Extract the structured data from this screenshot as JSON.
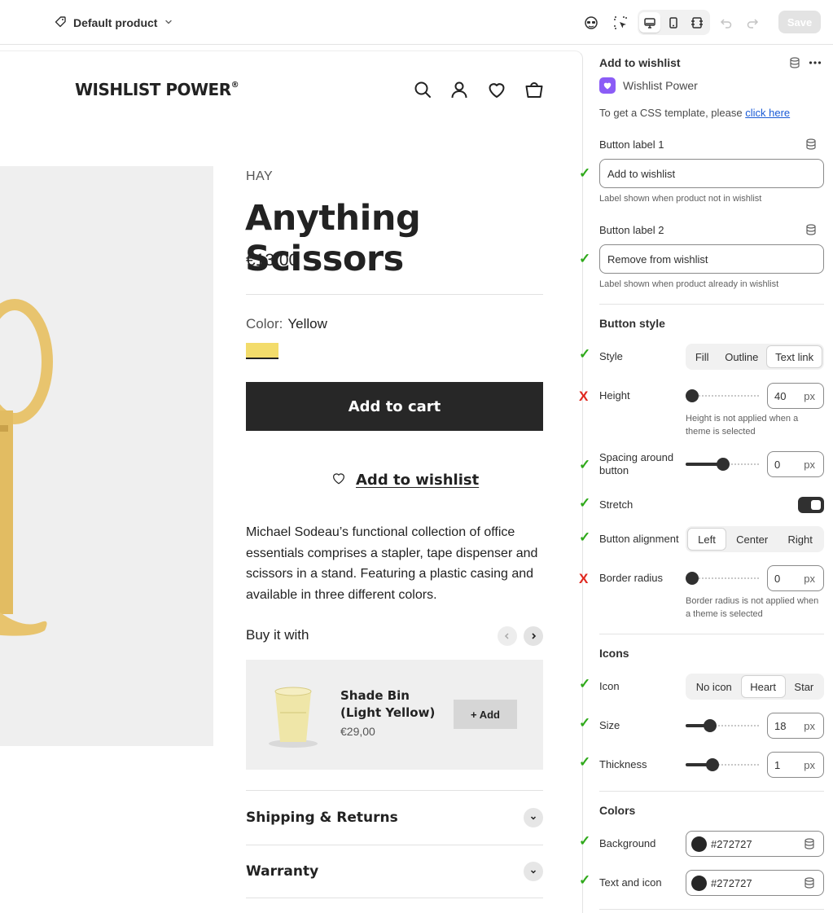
{
  "topbar": {
    "product_selector": "Default product",
    "save_label": "Save",
    "icons": [
      "tag-icon",
      "chevron-down-icon",
      "inspector-icon",
      "select-element-icon",
      "desktop-icon",
      "mobile-icon",
      "fullwidth-icon",
      "undo-icon",
      "redo-icon"
    ]
  },
  "store": {
    "logo": "WISHLIST POWER",
    "logo_mark": "®",
    "header_icons": [
      "search-icon",
      "account-icon",
      "wishlist-heart-icon",
      "cart-icon"
    ]
  },
  "product": {
    "vendor": "HAY",
    "title": "Anything Scissors",
    "price": "€13,00",
    "color_label": "Color:",
    "color_value": "Yellow",
    "swatch_color": "#f3dc6b",
    "add_to_cart": "Add to cart",
    "wishlist_button": "Add to wishlist",
    "description": "Michael Sodeau’s functional collection of office essentials comprises a stapler, tape dispenser and scissors in a stand. Featuring a plastic casing and available in three different colors.",
    "buy_with": "Buy it with",
    "recommendation": {
      "name": "Shade Bin (Light Yellow)",
      "price": "€29,00",
      "add_label": "+ Add"
    },
    "accordions": [
      "Shipping & Returns",
      "Warranty"
    ]
  },
  "panel": {
    "title": "Add to wishlist",
    "app_name": "Wishlist Power",
    "css_note_text": "To get a CSS template, please ",
    "css_note_link": "click here",
    "label1": {
      "label": "Button label 1",
      "value": "Add to wishlist",
      "help": "Label shown when product not in wishlist"
    },
    "label2": {
      "label": "Button label 2",
      "value": "Remove from wishlist",
      "help": "Label shown when product already in wishlist"
    },
    "button_style": {
      "heading": "Button style",
      "style_label": "Style",
      "style_options": [
        "Fill",
        "Outline",
        "Text link"
      ],
      "style_selected": "Text link",
      "height_label": "Height",
      "height_value": "40",
      "height_unit": "px",
      "height_help": "Height is not applied when a theme is selected",
      "spacing_label": "Spacing around button",
      "spacing_value": "0",
      "spacing_unit": "px",
      "stretch_label": "Stretch",
      "stretch_on": true,
      "alignment_label": "Button alignment",
      "alignment_options": [
        "Left",
        "Center",
        "Right"
      ],
      "alignment_selected": "Left",
      "radius_label": "Border radius",
      "radius_value": "0",
      "radius_unit": "px",
      "radius_help": "Border radius is not applied when a theme is selected"
    },
    "icons_section": {
      "heading": "Icons",
      "icon_label": "Icon",
      "icon_options": [
        "No icon",
        "Heart",
        "Star"
      ],
      "icon_selected": "Heart",
      "size_label": "Size",
      "size_value": "18",
      "size_unit": "px",
      "thickness_label": "Thickness",
      "thickness_value": "1",
      "thickness_unit": "px"
    },
    "colors": {
      "heading": "Colors",
      "background_label": "Background",
      "background_value": "#272727",
      "text_label": "Text and icon",
      "text_value": "#272727"
    },
    "markers": {
      "ok": "✓",
      "bad": "X"
    }
  }
}
